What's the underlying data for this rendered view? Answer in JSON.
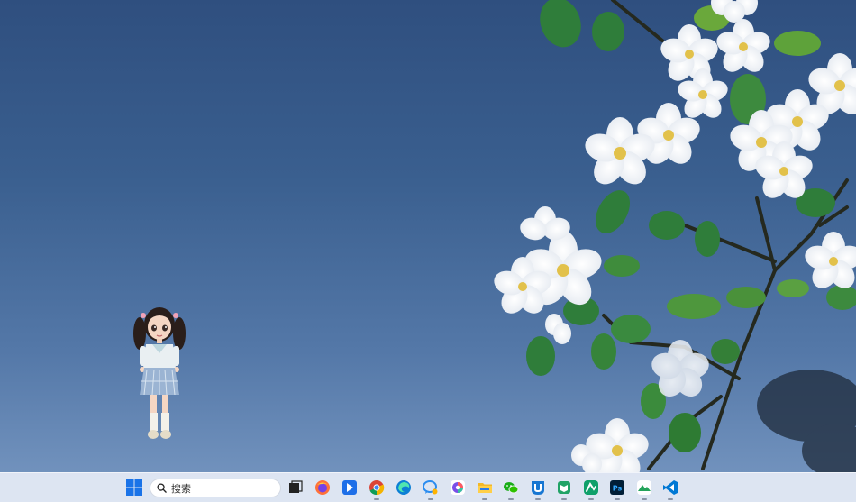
{
  "desktop": {
    "wallpaper": "blue-sky-white-blossoms",
    "colors": {
      "sky_top": "#2f4f7f",
      "sky_bottom": "#7898c2",
      "blossom": "#ffffff",
      "leaf": "#2f7d3a",
      "branch": "#2b2f2a"
    },
    "pet": {
      "name": "girl-figure",
      "description_icon": "desktop-pet-girl"
    }
  },
  "taskbar": {
    "search": {
      "placeholder": "搜索",
      "icon": "search-icon"
    },
    "items": [
      {
        "name": "start",
        "icon": "windows-logo-icon",
        "color": "#1a73e8",
        "running": false
      },
      {
        "name": "task-view",
        "icon": "task-view-icon",
        "color": "#222222",
        "running": false
      },
      {
        "name": "firefox",
        "icon": "firefox-icon",
        "color": "#ff7139",
        "running": false
      },
      {
        "name": "app-blue-arrow",
        "icon": "pointer-app-icon",
        "color": "#1e6fe8",
        "running": false
      },
      {
        "name": "chrome",
        "icon": "chrome-icon",
        "color": "#db4437",
        "running": true
      },
      {
        "name": "edge",
        "icon": "edge-icon",
        "color": "#0c7fd5",
        "running": false
      },
      {
        "name": "chat-app",
        "icon": "chat-bubble-icon",
        "color": "#2a8cf0",
        "running": true
      },
      {
        "name": "colorful-app",
        "icon": "colorful-app-icon",
        "color": "#7a4fe8",
        "running": false
      },
      {
        "name": "file-explorer",
        "icon": "folder-icon",
        "color": "#f3b827",
        "running": true
      },
      {
        "name": "wechat",
        "icon": "wechat-icon",
        "color": "#1aad19",
        "running": true
      },
      {
        "name": "blue-u-app",
        "icon": "u-app-icon",
        "color": "#1877d2",
        "running": true
      },
      {
        "name": "green-book-app",
        "icon": "green-book-icon",
        "color": "#21a366",
        "running": true
      },
      {
        "name": "green-app",
        "icon": "green-app-icon",
        "color": "#0fa06a",
        "running": true
      },
      {
        "name": "photoshop",
        "icon": "photoshop-icon",
        "color": "#31a8ff",
        "running": true
      },
      {
        "name": "mountain-app",
        "icon": "mountain-app-icon",
        "color": "#24a35a",
        "running": true
      },
      {
        "name": "vscode",
        "icon": "vscode-icon",
        "color": "#0078d4",
        "running": true
      }
    ]
  }
}
